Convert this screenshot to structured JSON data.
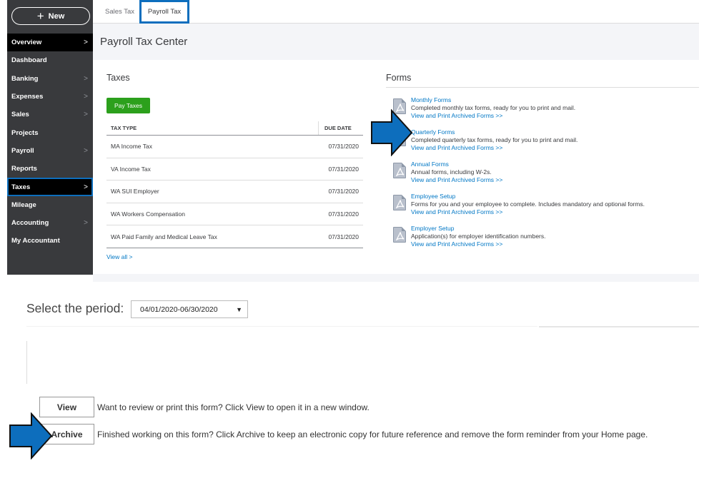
{
  "sidebar": {
    "new_label": "New",
    "items": [
      {
        "label": "Overview",
        "chevron": true
      },
      {
        "label": "Dashboard",
        "chevron": false
      },
      {
        "label": "Banking",
        "chevron": true
      },
      {
        "label": "Expenses",
        "chevron": true
      },
      {
        "label": "Sales",
        "chevron": true
      },
      {
        "label": "Projects",
        "chevron": false
      },
      {
        "label": "Payroll",
        "chevron": true
      },
      {
        "label": "Reports",
        "chevron": false
      },
      {
        "label": "Taxes",
        "chevron": true
      },
      {
        "label": "Mileage",
        "chevron": false
      },
      {
        "label": "Accounting",
        "chevron": true
      },
      {
        "label": "My Accountant",
        "chevron": false
      }
    ],
    "active": "Taxes"
  },
  "tabs": {
    "sales_tax": "Sales Tax",
    "payroll_tax": "Payroll Tax"
  },
  "page_title": "Payroll Tax Center",
  "taxes": {
    "title": "Taxes",
    "pay_button": "Pay Taxes",
    "headers": {
      "tax_type": "TAX TYPE",
      "due_date": "DUE DATE"
    },
    "rows": [
      {
        "type": "MA Income Tax",
        "due": "07/31/2020"
      },
      {
        "type": "VA Income Tax",
        "due": "07/31/2020"
      },
      {
        "type": "WA SUI Employer",
        "due": "07/31/2020"
      },
      {
        "type": "WA Workers Compensation",
        "due": "07/31/2020"
      },
      {
        "type": "WA Paid Family and Medical Leave Tax",
        "due": "07/31/2020"
      }
    ],
    "view_all": "View all >"
  },
  "forms": {
    "title": "Forms",
    "items": [
      {
        "name": "Monthly Forms",
        "desc": "Completed monthly tax forms, ready for you to print and mail.",
        "link": "View and Print Archived Forms >>"
      },
      {
        "name": "Quarterly Forms",
        "desc": "Completed quarterly tax forms, ready for you to print and mail.",
        "link": "View and Print Archived Forms >>"
      },
      {
        "name": "Annual Forms",
        "desc": "Annual forms, including W-2s.",
        "link": "View and Print Archived Forms >>"
      },
      {
        "name": "Employee Setup",
        "desc": "Forms for you and your employee to complete. Includes mandatory and optional forms.",
        "link": "View and Print Archived Forms >>"
      },
      {
        "name": "Employer Setup",
        "desc": "Application(s) for employer identification numbers.",
        "link": "View and Print Archived Forms >>"
      }
    ]
  },
  "period": {
    "label": "Select the period:",
    "selected": "04/01/2020-06/30/2020"
  },
  "actions": {
    "view_label": "View",
    "view_desc": "Want to review or print this form? Click View to open it in a new window.",
    "archive_label": "Archive",
    "archive_desc": "Finished working on this form? Click Archive to keep an electronic copy for future reference and remove the form reminder from your Home page."
  },
  "colors": {
    "sidebar_bg": "#393a3d",
    "highlight_blue": "#0d6ebd",
    "pay_green": "#2ca01c",
    "link_blue": "#0077c5"
  },
  "icons": [
    "plus-icon",
    "chevron-right-icon",
    "pdf-icon",
    "dropdown-caret-icon",
    "arrow-right-icon"
  ]
}
